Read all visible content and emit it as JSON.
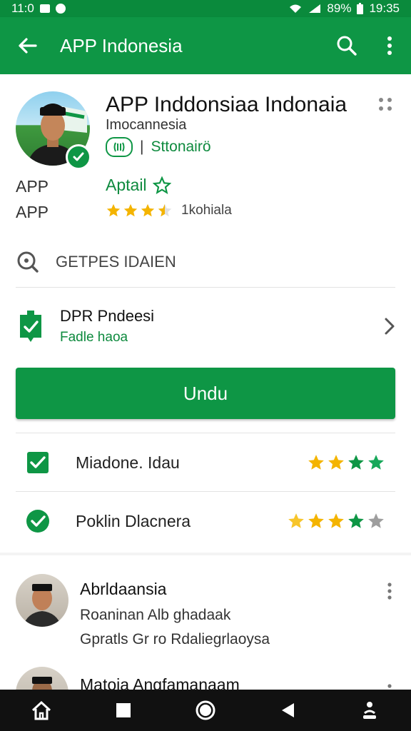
{
  "status_bar": {
    "time_left": "11:0",
    "battery": "89%",
    "time_right": "19:35"
  },
  "app_bar": {
    "title": "APP Indonesia"
  },
  "app": {
    "name": "APP Inddonsiaa Indonaia",
    "subtitle": "Imocannesia",
    "developer": "Sttonairö",
    "meta_label_1": "APP",
    "meta_label_2": "APP",
    "category": "Aptail",
    "rating_text": "1kohiala",
    "rating": 3.5
  },
  "search_row": {
    "label": "GETPES IDAIEN"
  },
  "update_row": {
    "title": "DPR Pndeesi",
    "subtitle": "Fadle haoa"
  },
  "primary_button": {
    "label": "Undu"
  },
  "checks": [
    {
      "label": "Miadone. Idau",
      "type": "checkbox"
    },
    {
      "label": "Poklin Dlacnera",
      "type": "radio-check"
    }
  ],
  "reviews": [
    {
      "name": "Abrldaansia",
      "line1": "Roaninan Alb ghadaak",
      "line2": "Gpratls Gr ro Rdaliegrlaoysa"
    },
    {
      "name": "Matoia Angfamanaam"
    }
  ],
  "colors": {
    "primary": "#0e9645",
    "star_gold": "#f4b400",
    "star_green": "#0e9645",
    "star_gray": "#9e9e9e"
  }
}
